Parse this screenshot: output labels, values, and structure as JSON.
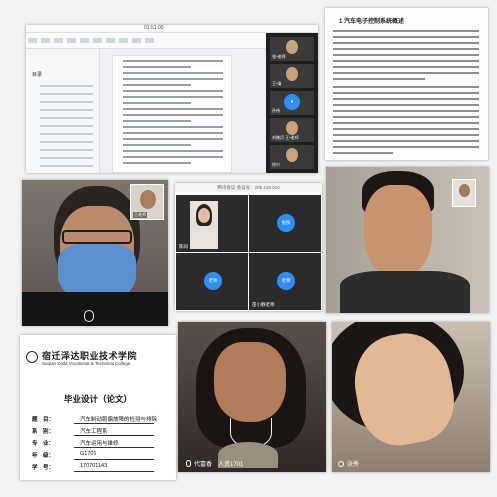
{
  "screen_share": {
    "time": "01:51:00",
    "nav_title": "目录",
    "participants": [
      {
        "name": "张*老师"
      },
      {
        "name": "王*清"
      },
      {
        "name": "孙伟"
      },
      {
        "name": "刘晓月 王*老师"
      },
      {
        "name": "徐兴"
      }
    ]
  },
  "paper": {
    "heading": "1 汽车电子控制系统概述"
  },
  "masked_call": {
    "pip_name": "王老师"
  },
  "video_grid": {
    "meeting_bar": "腾讯会议 会议号：205 218 010",
    "cells": [
      {
        "name": "陈同",
        "avatar": ""
      },
      {
        "name": "",
        "avatar": "张技"
      },
      {
        "name": "",
        "avatar": "老师"
      },
      {
        "name": "苗小静老师",
        "avatar": "老师"
      }
    ]
  },
  "thesis_cover": {
    "school": "宿迁泽达职业技术学院",
    "school_en": "Suqian Zeda Vocational & Technical College",
    "title": "毕业设计（论文）",
    "fields": [
      {
        "label": "题　目：",
        "value": "汽车制动跑偏故障的检测与排除"
      },
      {
        "label": "系　别：",
        "value": "汽车工程系"
      },
      {
        "label": "专　业：",
        "value": "汽车运用与维修"
      },
      {
        "label": "年　级：",
        "value": "G1701"
      },
      {
        "label": "学　号：",
        "value": "170701143"
      }
    ]
  },
  "call_left": {
    "caption": "代富香　人资1701"
  },
  "call_right": {
    "caption": "张秀"
  },
  "colors": {
    "accent_blue": "#2f8df5",
    "dark_tile": "#2b2b2b"
  }
}
